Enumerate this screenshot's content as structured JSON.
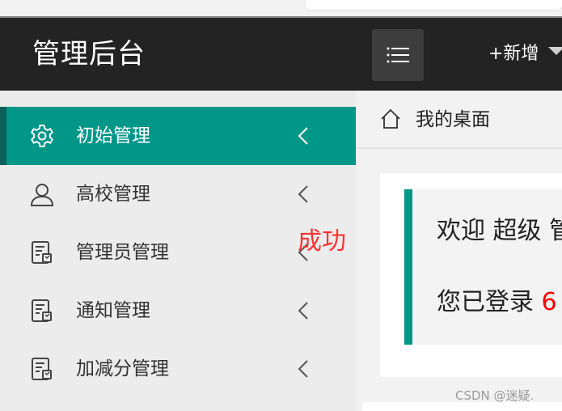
{
  "header": {
    "logo": "管理后台",
    "menu_toggle_icon": "hamburger-icon",
    "add_new_label": "+新增"
  },
  "sidebar": {
    "items": [
      {
        "label": "初始管理",
        "icon": "gear-icon",
        "active": true
      },
      {
        "label": "高校管理",
        "icon": "user-icon",
        "active": false
      },
      {
        "label": "管理员管理",
        "icon": "document-icon",
        "active": false
      },
      {
        "label": "通知管理",
        "icon": "document-icon",
        "active": false
      },
      {
        "label": "加减分管理",
        "icon": "document-icon",
        "active": false
      }
    ]
  },
  "overlay": {
    "success_text": "成功"
  },
  "tabs": {
    "home_icon": "home-icon",
    "current": "我的桌面"
  },
  "main": {
    "welcome_text": "欢迎 超级 管",
    "login_prefix": "您已登录 ",
    "login_count": "6"
  },
  "watermark": "CSDN @迷疑.",
  "colors": {
    "accent": "#009688",
    "accent_dark": "#0b6157",
    "header_bg": "#232323",
    "success": "#ff3333"
  }
}
